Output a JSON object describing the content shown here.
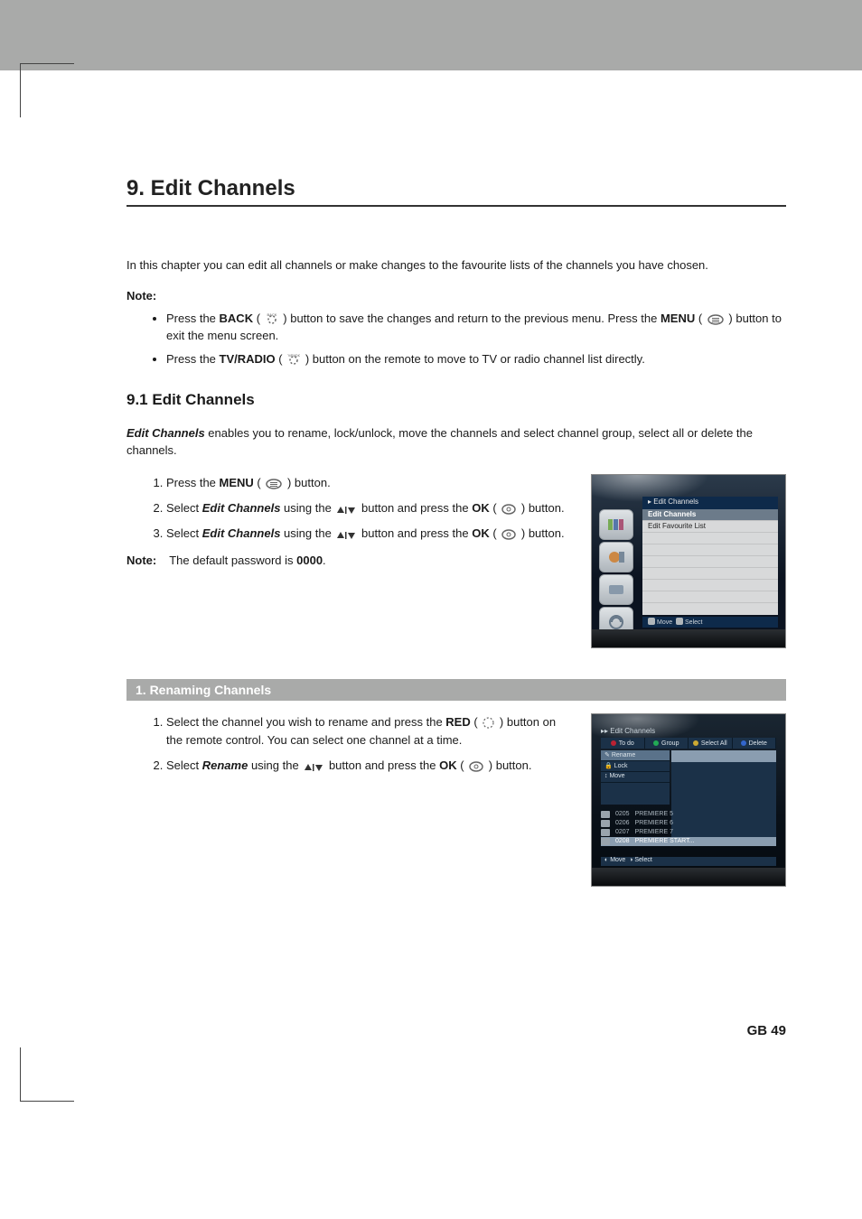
{
  "chapter_title": "9. Edit Channels",
  "intro": "In this chapter you can edit all channels or make changes to the favourite lists of the channels you have chosen.",
  "note_label": "Note:",
  "note_bullets": {
    "b1a": "Press the ",
    "b1_back": "BACK",
    "b1b": " ( ",
    "b1c": " ) button to save the changes and return to the previous menu. Press the ",
    "b1_menu": "MENU",
    "b1d": " ( ",
    "b1e": " ) button to exit the menu screen.",
    "b2a": "Press the ",
    "b2_tv": "TV/RADIO",
    "b2b": " ( ",
    "b2c": " ) button on the remote to move to TV or radio channel list directly."
  },
  "section_9_1": "9.1 Edit Channels",
  "sec_9_1_intro_a": "Edit Channels",
  "sec_9_1_intro_b": " enables you to rename, lock/unlock, move the channels and select channel group, select all or delete the channels.",
  "steps1": {
    "s1a": "Press the ",
    "s1_menu": "MENU",
    "s1b": " ( ",
    "s1c": " ) button.",
    "s2a": "Select ",
    "s2_ec": "Edit Channels",
    "s2b": " using the ",
    "s2c": " button and press the ",
    "s2_ok": "OK",
    "s2d": " ( ",
    "s2e": " ) button.",
    "s3a": "Select ",
    "s3_ec": "Edit Channels",
    "s3b": " using the ",
    "s3c": " button and press the ",
    "s3_ok": "OK",
    "s3d": " ( ",
    "s3e": " ) button."
  },
  "note2_label": "Note:",
  "note2_a": "The default password is ",
  "note2_b": "0000",
  "note2_c": ".",
  "subsection_1": "1. Renaming Channels",
  "steps2": {
    "s1a": "Select the channel you wish to rename and press the ",
    "s1_red": "RED",
    "s1b": " ( ",
    "s1c": " ) button on the remote control. You can select one channel at a time.",
    "s2a": "Select ",
    "s2_ren": "Rename",
    "s2b": " using the ",
    "s2c": " button and press the ",
    "s2_ok": "OK",
    "s2d": " ( ",
    "s2e": " ) button."
  },
  "fig1": {
    "title": "Edit Channels",
    "row1": "Edit Channels",
    "row2": "Edit Favourite List",
    "footer_move": "Move",
    "footer_select": "Select"
  },
  "fig2": {
    "crumb": "▸▸ Edit Channels",
    "tabs": [
      "To do",
      "Group",
      "Select All",
      "Delete"
    ],
    "menu": [
      "Rename",
      "Lock",
      "Move"
    ],
    "channels": [
      {
        "num": "0205",
        "name": "PREMIERE 5"
      },
      {
        "num": "0206",
        "name": "PREMIERE 6"
      },
      {
        "num": "0207",
        "name": "PREMIERE 7"
      },
      {
        "num": "0208",
        "name": "PREMIERE START..."
      }
    ],
    "footer_move": "Move",
    "footer_select": "Select"
  },
  "page_num": "GB 49"
}
